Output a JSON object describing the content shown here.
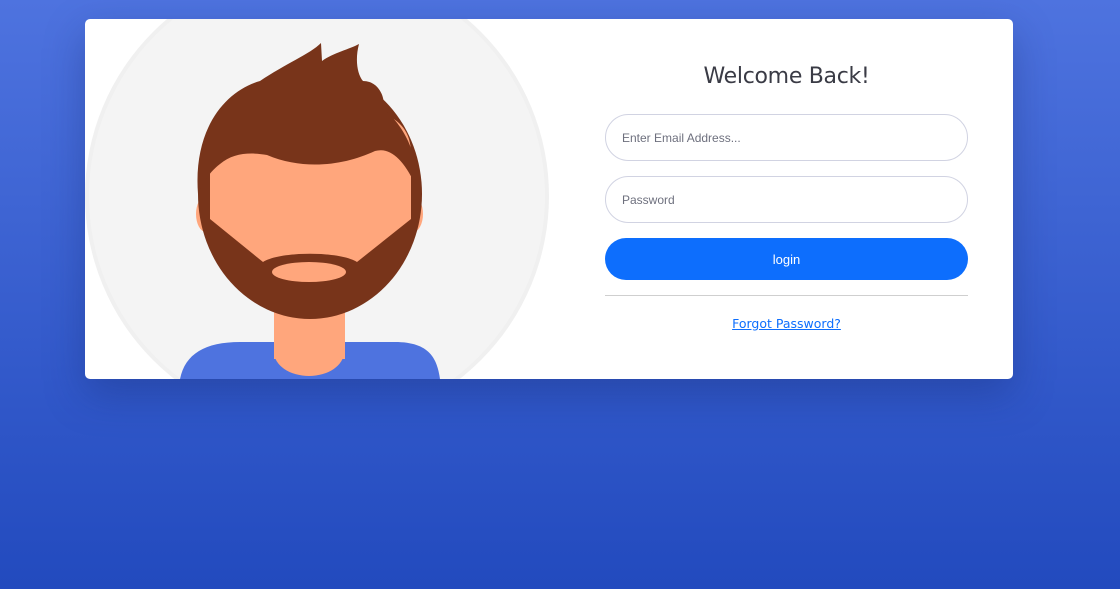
{
  "login": {
    "title": "Welcome Back!",
    "email_placeholder": "Enter Email Address...",
    "password_placeholder": "Password",
    "login_label": "login",
    "forgot_label": "Forgot Password?"
  },
  "icons": {
    "avatar": "avatar-illustration"
  },
  "colors": {
    "background_top": "#4e73df",
    "background_bottom": "#224abe",
    "card": "#ffffff",
    "button": "#0d6efd",
    "link": "#0d6efd",
    "hair": "#78341a",
    "skin": "#ffa67c",
    "shirt": "#4e73df",
    "circle": "#f4f4f4"
  }
}
